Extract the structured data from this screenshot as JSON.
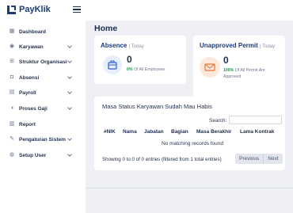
{
  "app": {
    "name": "PayKlik"
  },
  "sidebar": {
    "items": [
      {
        "label": "Dashboard",
        "icon": "dashboard-icon",
        "has_submenu": false
      },
      {
        "label": "Karyawan",
        "icon": "user-icon",
        "has_submenu": true
      },
      {
        "label": "Struktur Organisasi",
        "icon": "org-chart-icon",
        "has_submenu": true
      },
      {
        "label": "Absensi",
        "icon": "person-icon",
        "has_submenu": true
      },
      {
        "label": "Payroll",
        "icon": "payroll-icon",
        "has_submenu": true
      },
      {
        "label": "Proses Gaji",
        "icon": "process-icon",
        "has_submenu": true
      },
      {
        "label": "Report",
        "icon": "report-icon",
        "has_submenu": false
      },
      {
        "label": "Pengaturan Sistem",
        "icon": "wrench-icon",
        "has_submenu": true
      },
      {
        "label": "Setup User",
        "icon": "user-setup-icon",
        "has_submenu": true
      }
    ]
  },
  "page": {
    "title": "Home"
  },
  "absence_card": {
    "title": "Absence",
    "subtitle": "| Today",
    "count": "0",
    "percent": "0%",
    "caption": "Of All Employees",
    "icon": "briefcase-icon",
    "icon_bg": "#e8eefc",
    "icon_color": "#2d5bd0"
  },
  "permit_card": {
    "title": "Unapproved Permit",
    "subtitle": "| Today",
    "count": "0",
    "percent": "100%",
    "caption": "Of All Permit Are Approved",
    "icon": "envelope-icon",
    "icon_bg": "#fde9dc",
    "icon_color": "#e0763a"
  },
  "table_card": {
    "title": "Masa Status Karyawan Sudah Mau Habis",
    "search_label": "Search:",
    "columns": [
      "#NIK",
      "Nama",
      "Jabatan",
      "Bagian",
      "Masa Berakhir",
      "Lama Kontrak"
    ],
    "empty_message": "No matching records found",
    "info": "Showing 0 to 0 of 0 entries (filtered from 1 total entries)",
    "previous_label": "Previous",
    "next_label": "Next"
  },
  "colors": {
    "accent": "#1b3a7a",
    "success": "#1a9a4a",
    "background": "#eef0f5"
  }
}
